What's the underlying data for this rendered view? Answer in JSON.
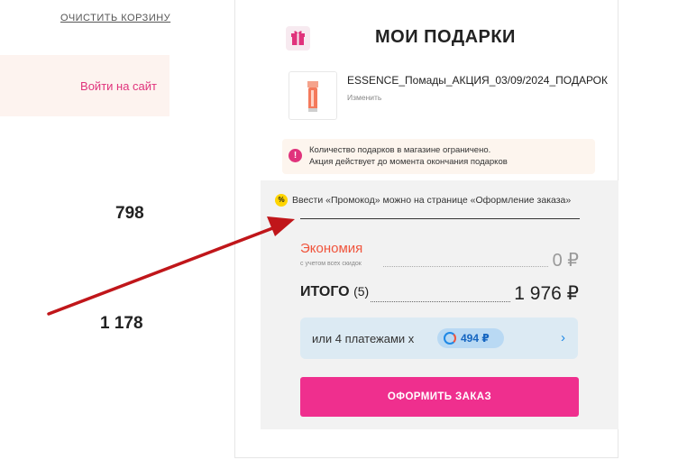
{
  "cart": {
    "clear_cart_label": "ОЧИСТИТЬ КОРЗИНУ",
    "login_label": "Войти на сайт",
    "left_value_1": "798",
    "left_value_2": "1 178"
  },
  "gifts": {
    "title": "МОИ ПОДАРКИ",
    "gift_icon": "gift-icon",
    "product_name": "ESSENCE_Помады_АКЦИЯ_03/09/2024_ПОДАРОК",
    "edit_label": "Изменить",
    "notice_line_1": "Количество подарков в магазине ограничено.",
    "notice_line_2": "Акция действует до момента окончания подарков"
  },
  "summary": {
    "promo_badge": "%",
    "promo_text": "Ввести «Промокод» можно на странице «Оформление заказа»",
    "economy_label": "Экономия",
    "economy_sub": "с учетом всех скидок",
    "economy_value": "0 ₽",
    "total_label": "ИТОГО",
    "total_count": "(5)",
    "total_value": "1 976 ₽",
    "installments_text": "или 4 платежами х",
    "installment_amount": "494 ₽",
    "checkout_label": "ОФОРМИТЬ ЗАКАЗ"
  },
  "colors": {
    "accent_pink": "#ef2f8e",
    "economy_orange": "#f0543c",
    "annotation_arrow": "#c0161a"
  }
}
